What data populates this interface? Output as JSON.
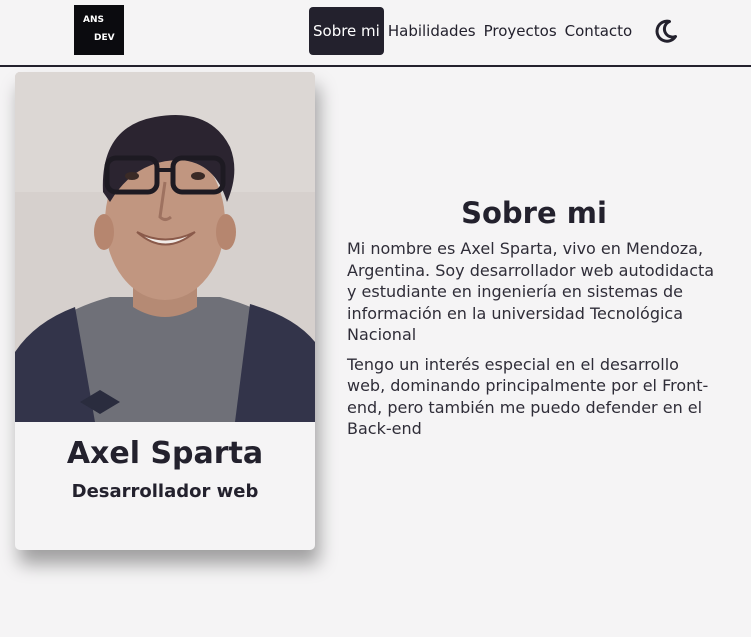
{
  "header": {
    "logo": {
      "line1": "ANS",
      "line2": "DEV"
    },
    "nav": [
      {
        "label": "Sobre mi",
        "active": true
      },
      {
        "label": "Habilidades",
        "active": false
      },
      {
        "label": "Proyectos",
        "active": false
      },
      {
        "label": "Contacto",
        "active": false
      }
    ],
    "theme_toggle_icon": "moon-icon"
  },
  "card": {
    "photo_icon": "profile-photo",
    "name": "Axel Sparta",
    "role": "Desarrollador web"
  },
  "about": {
    "title": "Sobre mi",
    "paragraphs": [
      "Mi nombre es Axel Sparta, vivo en Mendoza, Argentina. Soy desarrollador web autodidacta y estudiante en ingeniería en sistemas de información en la universidad Tecnológica Nacional",
      "Tengo un interés especial en el desarrollo web, dominando principalmente por el Front-end, pero también me puedo defender en el Back-end"
    ]
  },
  "colors": {
    "background": "#f5f4f5",
    "text": "#23212d",
    "accent": "#23212d"
  }
}
